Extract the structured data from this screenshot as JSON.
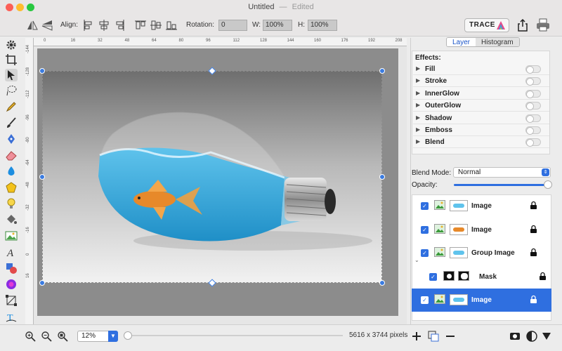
{
  "window": {
    "title": "Untitled",
    "state": "Edited"
  },
  "toolbar": {
    "align_label": "Align:",
    "rotation_label": "Rotation:",
    "rotation_value": "0",
    "w_label": "W:",
    "w_value": "100%",
    "h_label": "H:",
    "h_value": "100%",
    "trace_label": "TRACE",
    "icons": [
      "flip-horizontal-icon",
      "flip-vertical-icon",
      "align-left-icon",
      "align-center-icon",
      "align-right-icon",
      "align-top-icon",
      "align-middle-icon",
      "align-bottom-icon",
      "share-icon",
      "print-icon"
    ]
  },
  "rulers": {
    "top_ticks": [
      "0",
      "16",
      "32",
      "48",
      "64",
      "80",
      "96",
      "112",
      "128",
      "144",
      "160",
      "176",
      "192",
      "208"
    ],
    "left_ticks": [
      "-144",
      "-128",
      "-112",
      "-96",
      "-80",
      "-64",
      "-48",
      "-32",
      "-16",
      "0",
      "16"
    ]
  },
  "panel": {
    "tabs": [
      "Layer",
      "Histogram"
    ],
    "active_tab": "Layer",
    "effects_title": "Effects:",
    "effects": [
      {
        "name": "Fill",
        "enabled": false
      },
      {
        "name": "Stroke",
        "enabled": false
      },
      {
        "name": "InnerGlow",
        "enabled": false
      },
      {
        "name": "OuterGlow",
        "enabled": false
      },
      {
        "name": "Shadow",
        "enabled": false
      },
      {
        "name": "Emboss",
        "enabled": false
      },
      {
        "name": "Blend",
        "enabled": false
      }
    ],
    "blend_mode_label": "Blend Mode:",
    "blend_mode_value": "Normal",
    "opacity_label": "Opacity:",
    "opacity_value": 1.0,
    "layers": [
      {
        "name": "Image",
        "checked": true,
        "locked": true,
        "selected": false
      },
      {
        "name": "Image",
        "checked": true,
        "locked": true,
        "selected": false
      },
      {
        "name": "Group Image",
        "checked": true,
        "locked": true,
        "selected": false,
        "expanded": true
      },
      {
        "name": "Mask",
        "checked": true,
        "locked": true,
        "selected": false,
        "child": true
      },
      {
        "name": "Image",
        "checked": true,
        "locked": true,
        "selected": true
      }
    ]
  },
  "bottom": {
    "zoom_value": "12%",
    "image_size": "5616 x 3744 pixels"
  },
  "colors": {
    "accent": "#2f6fe0",
    "canvas_bg": "#8c8c8c",
    "water": "#3fa9d8"
  }
}
